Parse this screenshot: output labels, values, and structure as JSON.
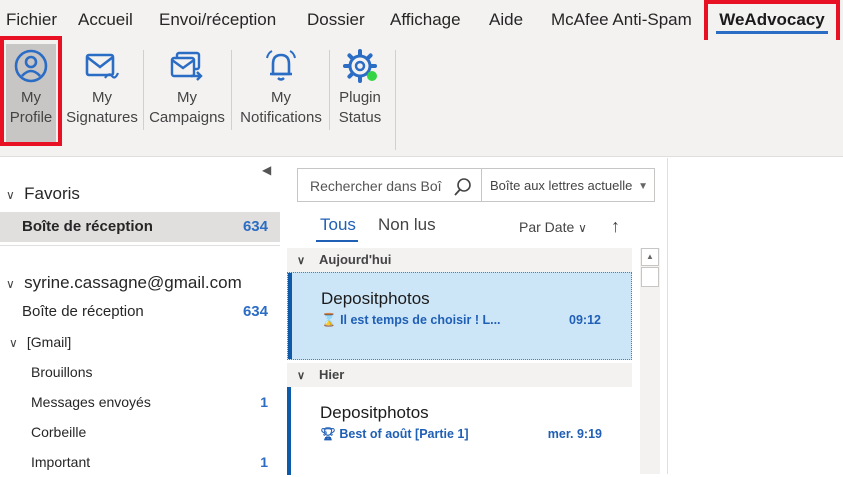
{
  "tabs": [
    "Fichier",
    "Accueil",
    "Envoi/réception",
    "Dossier",
    "Affichage",
    "Aide",
    "McAfee Anti-Spam",
    "WeAdvocacy"
  ],
  "active_tab": "WeAdvocacy",
  "ribbon": {
    "my_profile": [
      "My",
      "Profile"
    ],
    "my_signatures": [
      "My",
      "Signatures"
    ],
    "my_campaigns": [
      "My",
      "Campaigns"
    ],
    "my_notifications": [
      "My",
      "Notifications"
    ],
    "plugin_status": [
      "Plugin",
      "Status"
    ]
  },
  "colors": {
    "accent": "#2b6cc4",
    "highlight": "#e81123",
    "status_ok": "#35d445",
    "selected_msg": "#cde6f7"
  },
  "folders": {
    "favorites_label": "Favoris",
    "favorites_inbox": {
      "label": "Boîte de réception",
      "count": "634"
    },
    "account": "syrine.cassagne@gmail.com",
    "inbox": {
      "label": "Boîte de réception",
      "count": "634"
    },
    "gmail": "[Gmail]",
    "drafts": {
      "label": "Brouillons"
    },
    "sent": {
      "label": "Messages envoyés",
      "count": "1"
    },
    "trash": {
      "label": "Corbeille"
    },
    "important": {
      "label": "Important",
      "count": "1"
    }
  },
  "search": {
    "placeholder": "Rechercher dans Boî",
    "scope": "Boîte aux lettres actuelle"
  },
  "filter": {
    "all": "Tous",
    "unread": "Non lus",
    "sort": "Par Date"
  },
  "groups": {
    "today": "Aujourd'hui",
    "yesterday": "Hier"
  },
  "messages": [
    {
      "from": "Depositphotos",
      "subject": "Il est temps de choisir ! L...",
      "time": "09:12",
      "icon": "hourglass-icon"
    },
    {
      "from": "Depositphotos",
      "subject": "Best of août [Partie 1]",
      "time": "mer. 9:19",
      "icon": "trophy-icon"
    }
  ]
}
